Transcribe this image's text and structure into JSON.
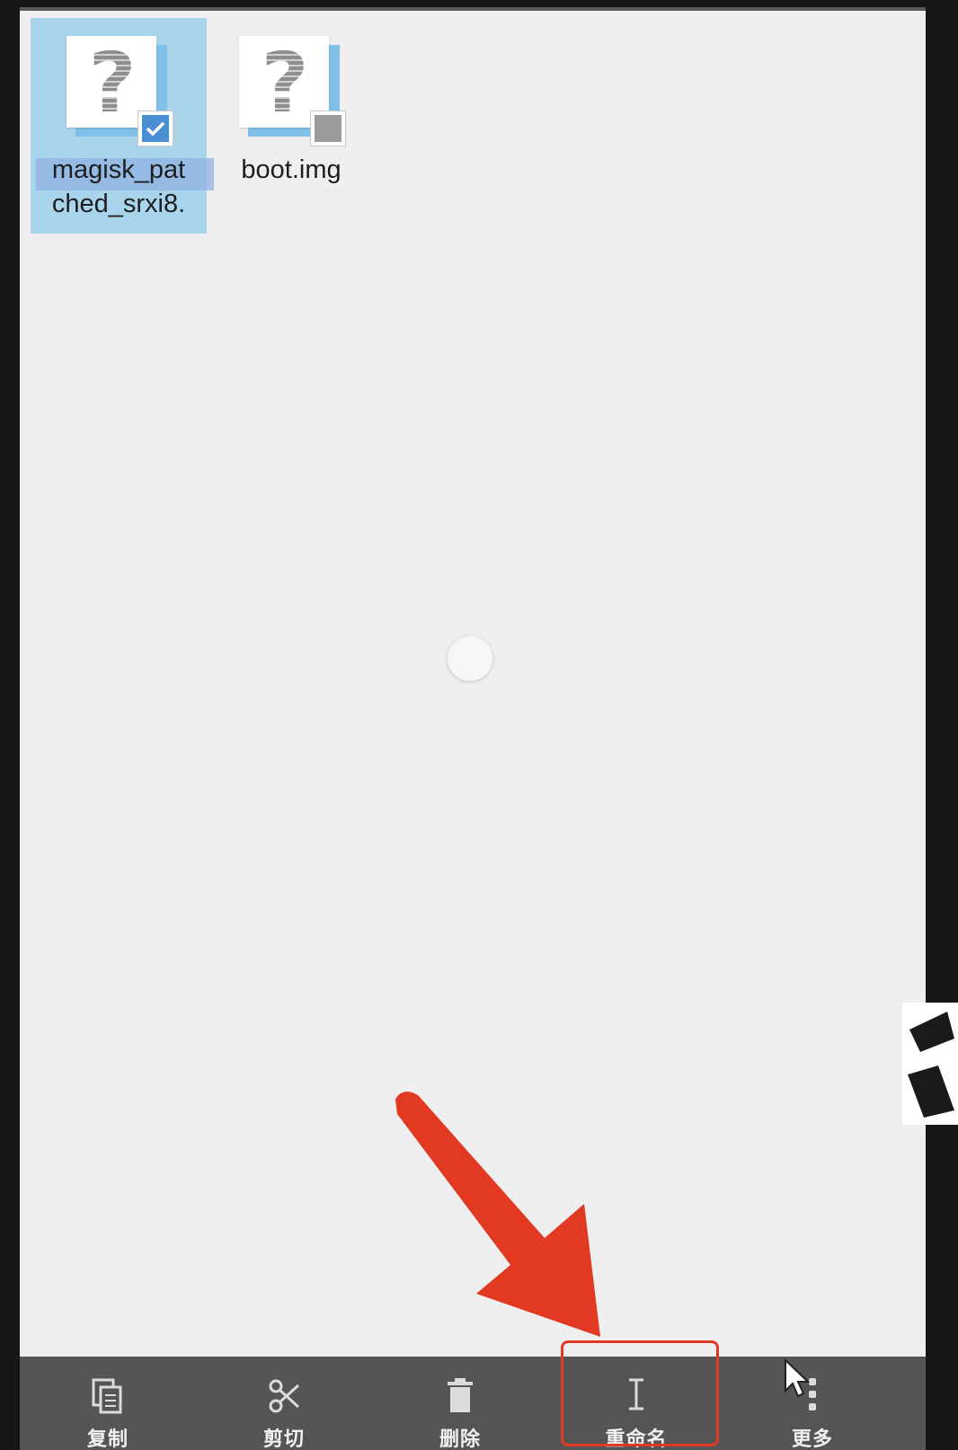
{
  "files": [
    {
      "name": "magisk_pat\nched_srxi8.",
      "selected": true,
      "icon": "unknown-file-icon"
    },
    {
      "name": "boot.img",
      "selected": false,
      "icon": "unknown-file-icon"
    }
  ],
  "toolbar": {
    "copy_label": "复制",
    "cut_label": "剪切",
    "delete_label": "删除",
    "rename_label": "重命名",
    "more_label": "更多"
  },
  "colors": {
    "selection": "#a9d5ec",
    "check_on": "#4a8fd4",
    "toolbar_bg": "#555555",
    "annotation": "#e23a22"
  }
}
